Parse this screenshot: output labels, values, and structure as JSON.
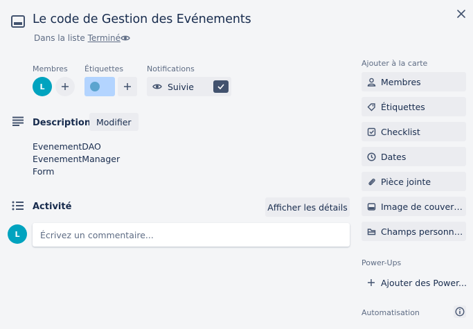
{
  "card": {
    "title": "Le code de Gestion des Evénements",
    "list_prefix": "Dans la liste ",
    "list_name": "Terminé"
  },
  "members": {
    "label": "Membres",
    "avatar_initial": "L"
  },
  "labels": {
    "label": "Étiquettes",
    "chip_color": "#b3d4ff",
    "dot_color": "#5ba4cf"
  },
  "notifications": {
    "label": "Notifications",
    "watch_label": "Suivie",
    "watching": true
  },
  "description": {
    "title": "Description",
    "edit_label": "Modifier",
    "lines": [
      "EvenementDAO",
      "EvenementManager",
      "Form"
    ]
  },
  "activity": {
    "title": "Activité",
    "details_label": "Afficher les détails",
    "avatar_initial": "L",
    "comment_placeholder": "Écrivez un commentaire..."
  },
  "sidebar": {
    "add_to_card_label": "Ajouter à la carte",
    "items": [
      {
        "label": "Membres",
        "icon": "person-icon"
      },
      {
        "label": "Étiquettes",
        "icon": "tag-icon"
      },
      {
        "label": "Checklist",
        "icon": "checklist-icon"
      },
      {
        "label": "Dates",
        "icon": "clock-icon"
      },
      {
        "label": "Pièce jointe",
        "icon": "paperclip-icon"
      },
      {
        "label": "Image de couvert...",
        "icon": "cover-icon"
      },
      {
        "label": "Champs personnalis...",
        "icon": "fields-icon"
      }
    ],
    "powerups_label": "Power-Ups",
    "add_powerups_label": "Ajouter des Power...",
    "automation_label": "Automatisation"
  },
  "colors": {
    "avatar": "#00a3bf",
    "watch_check": "#42526e",
    "background": "#f4f5f7"
  }
}
